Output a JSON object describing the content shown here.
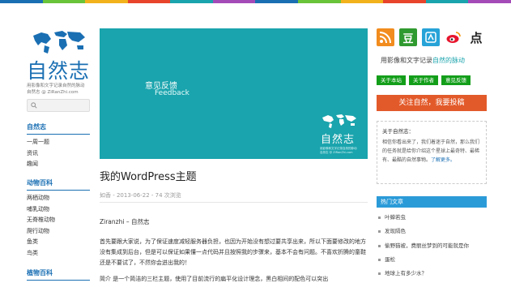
{
  "topbar_colors": [
    "#1a6fb3",
    "#6ac43a",
    "#f2b21b",
    "#e8432b",
    "#1aa4ad",
    "#a44bb8",
    "#1a6fb3",
    "#6ac43a",
    "#f2b21b",
    "#e8432b",
    "#1aa4ad",
    "#a44bb8"
  ],
  "logo": {
    "brand": "自然志",
    "tagline": "用影像和文字记录自然的脉动",
    "url_line": "自然志 @ ZiRanZhi.com"
  },
  "sidebar": {
    "sections": [
      {
        "heading": "自然志",
        "items": [
          "一周一题",
          "资讯",
          "趣闻"
        ]
      },
      {
        "heading": "动物百科",
        "items": [
          "两栖动物",
          "哺乳动物",
          "无脊椎动物",
          "爬行动物",
          "鱼类",
          "鸟类"
        ]
      },
      {
        "heading": "植物百科",
        "items": []
      }
    ]
  },
  "hero": {
    "title_cn": "意见反馈",
    "title_en": "Feedback",
    "watermark": "自然志",
    "watermark_tag1": "用影像和文字记录自然的脉动",
    "watermark_tag2": "自然志 @ ZiRanZhi.com"
  },
  "post": {
    "title": "我的WordPress主题",
    "meta": "如香 - 2013-06-22 - 74 次浏览",
    "author_line": "Ziranzhi – 自然志",
    "paragraph": "首先要跟大家说，为了保证速度减轻服务器负担，也因为开始没有想过要共享出来，所以下面要修改的地方没有集成到后台，但是可以保证如果懂一点代码并且按照我的步骤来，基本不会有问题。不喜欢折腾的童鞋还是不要试了，不然你会迸出我的！",
    "next_line": "简介     是一个简洁的三栏主题，使用了目前流行的扁平化设计理念，黑白相间的配色可以突出"
  },
  "social_icons": [
    {
      "name": "rss-icon",
      "color": "#f28c1e"
    },
    {
      "name": "douban-icon",
      "color": "#2f9a2f",
      "glyph": "豆"
    },
    {
      "name": "qzone-icon",
      "color": "#27a3d8"
    },
    {
      "name": "weibo-icon",
      "color": "#ffffff"
    },
    {
      "name": "dianping-icon",
      "color": "#ffffff",
      "glyph": "点"
    }
  ],
  "slogan": {
    "a": "用",
    "b": "影像",
    "c": "和",
    "d": "文字",
    "e": "记录",
    "f": "自然的脉动"
  },
  "buttons": [
    "关于本站",
    "关于作者",
    "意见反馈"
  ],
  "follow_button": "关注自然，我要投稿",
  "about": {
    "heading": "关于自然志：",
    "body": "相信你看出来了，我们着迷于自然，那么我们的任务就是给你介绍这个星球上最奇特、最稀有、最酷的自然事物。",
    "more": "了解更多。"
  },
  "hot": {
    "heading": "热门文章",
    "items": [
      "叶蝉若虫",
      "发现隔色",
      "偷野猫被，费丽丝梦到的可能就是你",
      "蛋松",
      "地球上有多少水？"
    ]
  }
}
